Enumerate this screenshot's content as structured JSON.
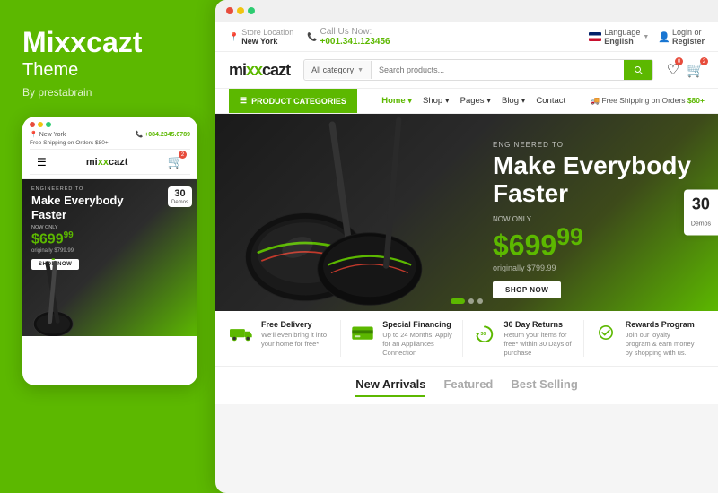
{
  "left": {
    "brand": "Mixxcazt",
    "subtitle": "Theme",
    "by": "By prestabrain"
  },
  "mobile": {
    "location_label": "New York",
    "phone": "+084.2345.6789",
    "shipping": "Free Shipping on Orders $80+",
    "logo": "mixxcazt",
    "dots": [
      "#e74c3c",
      "#f1c40f",
      "#2ecc71"
    ],
    "engineered_to": "ENGINEERED TO",
    "headline_line1": "Make Everybody",
    "headline_line2": "Faster",
    "price_label": "NOW ONLY",
    "price_main": "$699",
    "price_cents": "99",
    "price_original": "originally $799.99",
    "shop_btn": "SHOP NOW",
    "badge_num": "30",
    "badge_label": "Demos"
  },
  "desktop": {
    "browser_dots": [
      "#e74c3c",
      "#f1c40f",
      "#2ecc71"
    ],
    "topbar": {
      "store_label": "Store Location",
      "store_value": "New York",
      "call_label": "Call Us Now:",
      "phone": "+001.341.123456",
      "language_label": "Language",
      "language_value": "English",
      "login": "Login or",
      "register": "Register"
    },
    "search": {
      "logo": "mixxcazt",
      "category_placeholder": "All category",
      "search_placeholder": "Search products..."
    },
    "nav": {
      "categories_btn": "Product Categories",
      "links": [
        "Home",
        "Shop",
        "Pages",
        "Blog",
        "Contact"
      ],
      "free_shipping": "Free Shipping on Orders $80+"
    },
    "hero": {
      "engineered_to": "ENGINEERED TO",
      "headline_line1": "Make Everybody",
      "headline_line2": "Faster",
      "price_label": "NOW ONLY",
      "price_main": "$699",
      "price_sup": "99",
      "price_original": "originally $799.99",
      "shop_btn": "SHOP NOW",
      "badge_num": "30",
      "badge_label": "Demos"
    },
    "features": [
      {
        "icon": "truck",
        "title": "Free Delivery",
        "desc": "We'll even bring it into your home for free*"
      },
      {
        "icon": "card",
        "title": "Special Financing",
        "desc": "Up to 24 Months. Apply for an Appliances Connection"
      },
      {
        "icon": "return",
        "title": "30 Day Returns",
        "desc": "Return your items for free* within 30 Days of purchase"
      },
      {
        "icon": "rewards",
        "title": "Rewards Program",
        "desc": "Join our loyalty program & earn money by shopping with us."
      }
    ],
    "tabs": [
      {
        "label": "New Arrivals",
        "active": true
      },
      {
        "label": "Featured",
        "active": false
      },
      {
        "label": "Best Selling",
        "active": false
      }
    ]
  },
  "colors": {
    "primary": "#5cb800",
    "dark": "#222222",
    "gray": "#888888"
  }
}
